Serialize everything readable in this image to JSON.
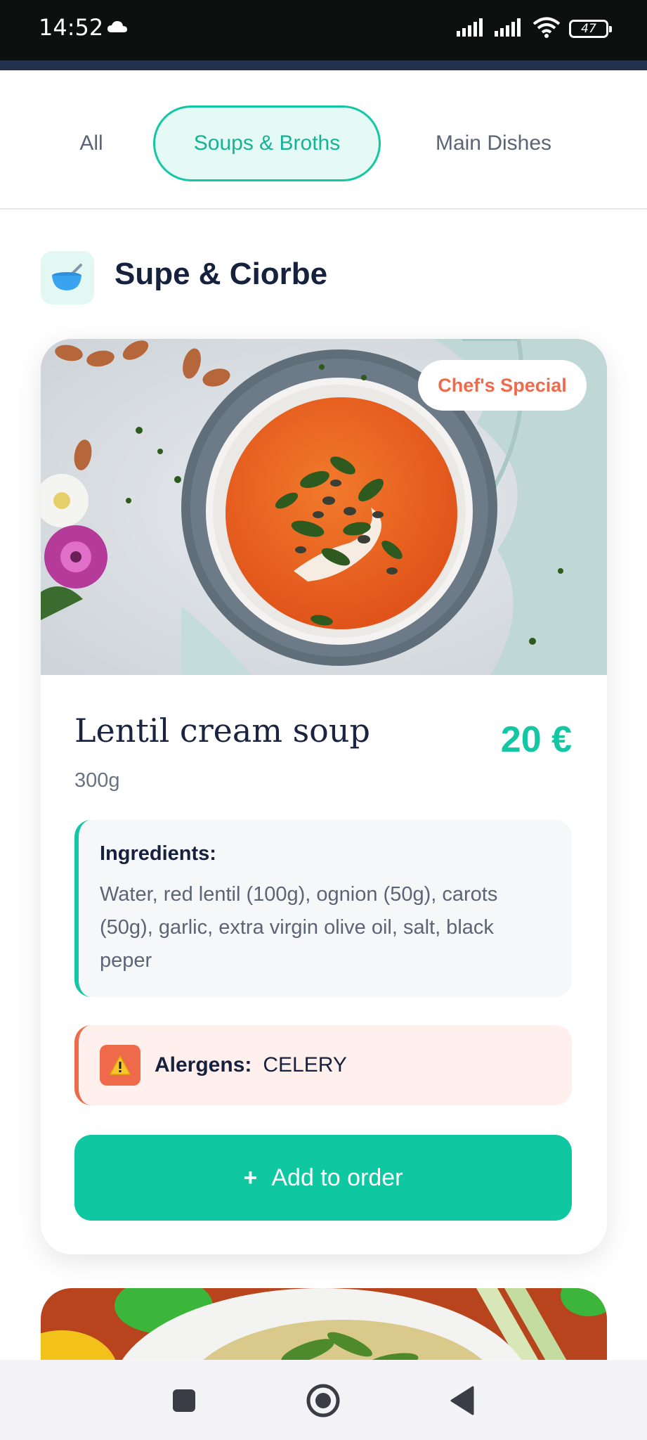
{
  "status_bar": {
    "time": "14:52",
    "battery": "47"
  },
  "tabs": [
    {
      "label": "All",
      "active": false
    },
    {
      "label": "Soups & Broths",
      "active": true
    },
    {
      "label": "Main Dishes",
      "active": false
    }
  ],
  "section": {
    "title": "Supe & Ciorbe",
    "icon": "soup-bowl-icon"
  },
  "dish": {
    "badge": "Chef's Special",
    "name": "Lentil cream soup",
    "price": "20 €",
    "weight": "300g",
    "ingredients_title": "Ingredients:",
    "ingredients": "Water, red lentil (100g), ognion (50g), carots (50g), garlic, extra virgin olive oil, salt, black peper",
    "allergens_label": "Alergens:",
    "allergens_value": "CELERY",
    "add_button_icon": "+",
    "add_button_label": "Add to order"
  },
  "colors": {
    "accent": "#14c7a4",
    "warning": "#ef6a4a",
    "title": "#16213d",
    "status_bar": "#0c1110"
  },
  "nav": {
    "recents": "square-icon",
    "home": "circle-icon",
    "back": "triangle-back-icon"
  }
}
